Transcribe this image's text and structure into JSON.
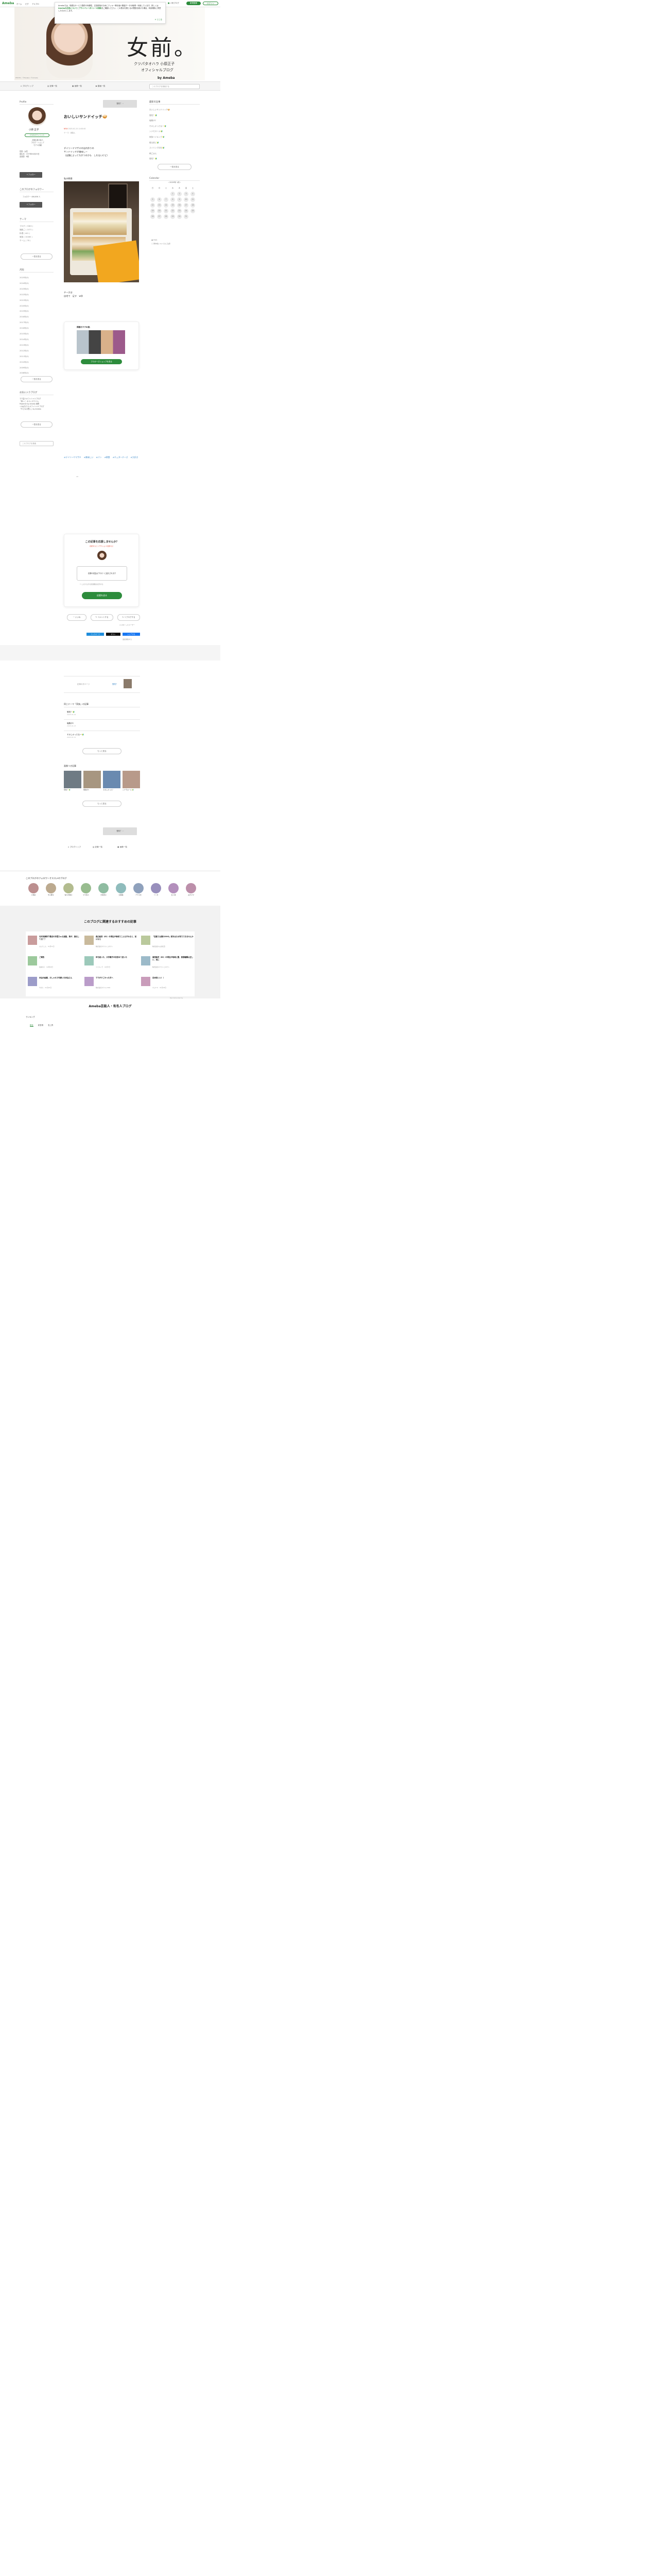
{
  "header": {
    "logo": "Ameba",
    "nav": [
      "ホーム",
      "ピグ",
      "アメブロ"
    ],
    "popular": "人気ブログ",
    "register": "新規登録",
    "login": "ログイン"
  },
  "cookie": {
    "text_a": "Amebaでは、快適なサービス提供や利便性、広告配信のためにクッキー等を個人関連データの取得・利用しています。詳しくは",
    "link1": "Amebaの広告について",
    "mid": "と",
    "link2": "プライバシーポリシーの規約",
    "text_b": "をご確認ください。この表示を閉じるか閲覧を続けた場合、利用規約に同意したものとします。",
    "close": "とじる"
  },
  "hero": {
    "title": "女前。",
    "sub1": "クツパタオハラ 小原正子",
    "sub2": "オフィシャルブログ",
    "by": "by Ameba",
    "photo_credit": "PHOTO：©Tanaka / ©Ameba"
  },
  "navbar": {
    "items": [
      "ブログトップ",
      "記事一覧",
      "画像一覧",
      "動画一覧"
    ],
    "search_placeholder": "このブログを検索する"
  },
  "left": {
    "profile_title": "Profile",
    "name": "小原 正子",
    "badge": "Amebaオフィシャル",
    "lines": [
      "大阪出身の芸人",
      "ブログ・ショップ",
      "モデル情報"
    ],
    "info": [
      "性別：女性",
      "誕生日：1975年04月25日",
      "血液型：B型"
    ],
    "follow_btn": "＋フォロー",
    "follower_title": "このブログのフォロワー",
    "follower_count": "フォロワー 406,656 人",
    "follow_btn2": "＋フォロー",
    "theme_title": "テーマ",
    "themes": [
      "ブログ ( 3363 )",
      "撮影ご ( 1071 )",
      "料理 ( 441 )",
      "家族 ( 10460 )",
      "チーム ( 78 )"
    ],
    "theme_more": "一覧を見る",
    "month_title": "月別",
    "months": [
      "2025年(0)",
      "2024年(0)",
      "2023年(0)",
      "2022年(0)",
      "2021年(0)",
      "2020年(0)",
      "2019年(0)",
      "2018年(0)",
      "2017年(0)",
      "2016年(0)",
      "2015年(0)",
      "2014年(0)",
      "2013年(0)",
      "2012年(0)",
      "2011年(0)",
      "2010年(0)",
      "2009年(0)",
      "2008年(0)"
    ],
    "month_more": "一覧を見る",
    "fav_title": "お気に入りブログ",
    "fav_lines": [
      "ママ芸人オフィシャルブログ",
      "「東っこ オペンスマイル」",
      "Powered by Ameba 東野",
      "くわばたりえオフィシャルブログ",
      "「やさ＆の思い」by Ameba"
    ],
    "fav_more": "一覧を見る",
    "search_placeholder": "このブログを検索"
  },
  "article": {
    "register_btn": "登校？",
    "title": "おいしいサンドイッチ🥪",
    "date_label": "NEW",
    "date": "2025-01-15 11:00:00",
    "theme": "テーマ：家族ん",
    "body": [
      "デイリーヤマザキの店内作りの",
      "サンドイッチが美味しー",
      "（店舗によってちがうのかも　しれないけど）"
    ],
    "photo_caption": "私の朝食",
    "after": [
      "チーズは",
      "自宅で　足す　w😄"
    ],
    "reco_title": "掲載おすすめ🛍",
    "reco_btn": "ブロガーズショップを見る",
    "tags": [
      "#デイリーヤマザキ",
      "#美味しい",
      "#パン",
      "#朝食",
      "#チェダーチーズ",
      "#大好き"
    ],
    "ad_label": "AD",
    "cheer_title": "この記事を応援しませんか？",
    "cheer_sub": "応援するとリアクションを送れる！",
    "cheer_box": "応援の収益はブロガーに還元されます",
    "cheer_note": "このブログの応援数を表示する",
    "cheer_btn": "応援を送る",
    "reactions": [
      "いいね",
      "コメントする",
      "リブログする"
    ],
    "reaction_count": "いいね！したユーザー",
    "share": [
      "ブックマーク",
      "ポスト",
      "シェアする"
    ],
    "report": "違反報告する",
    "prev": "記事の次ページ",
    "next": "登校？",
    "same_theme": "同じテーマ「家族」の記事",
    "same_list": [
      {
        "t": "登校？🔰",
        "d": "2025-01-14"
      },
      {
        "t": "瑠素がC",
        "d": "2025-01-13"
      },
      {
        "t": "そのしかったなー🔰",
        "d": "2025-01-12"
      }
    ],
    "same_more": "もっと見る",
    "img_title": "画像つき記事",
    "img_list": [
      "登校？🔰",
      "瑠素がC",
      "そのしかった？",
      "シナモロール🔰"
    ],
    "img_more": "もっと見る",
    "bottom_btn": "登校？",
    "bottom_nav": [
      "ブログトップ",
      "記事一覧",
      "画像一覧"
    ]
  },
  "right": {
    "recent_title": "最新の記事",
    "recent": [
      "おいしいサンドイッチ🥪",
      "登校？🔰",
      "瑠素がC",
      "そのしかったなー🔰",
      "シナモロール🔰",
      "家族ハイキング🔰",
      "寝る前に🔰",
      "スイミング初日🔰",
      "朝ごはん",
      "登校？🔰"
    ],
    "recent_more": "一覧を見る",
    "cal_title": "Calendar",
    "cal_month": "2025年 1月",
    "week": [
      "日",
      "月",
      "火",
      "水",
      "木",
      "金",
      "土"
    ],
    "rss": "RSS",
    "rss2": "著作権についてのご注意"
  },
  "followers": {
    "title": "このブログのフォロワーオススメのブログ",
    "items": [
      "小林彩",
      "牛川慶子",
      "佐々木優子",
      "ママ芸人",
      "大和田子",
      "辻貴美",
      "アナ子を",
      "ソンタ",
      "五人真",
      "みきママ"
    ]
  },
  "related": {
    "title": "このブログに関連するおすすめの記事",
    "items": [
      {
        "t": "元天気嬢柿下最近の手提ひゅる酒胆、茶が、進化してる？？",
        "s": "ももりこん",
        "d": "01月31日"
      },
      {
        "t": "森辺紹安（62）の現住が地域でこんな子みると、前川なら",
        "s": "株式会社ネクストコネクト",
        "d": ""
      },
      {
        "t": "「芸能では最のOOG」家計はなぜ何でできませんか",
        "s": "株式会社Q公益社団",
        "d": ""
      },
      {
        "t": "ご報告",
        "s": "佐藤文子",
        "d": "02月08日"
      },
      {
        "t": "年を経った、大学義子の収初めて送った",
        "s": "ミスキャラ",
        "d": "01月7日"
      },
      {
        "t": "高田紘史（62）の現住が地域に置、普通種類は正しい、気に",
        "s": "株式会社ネクストコネクト",
        "d": ""
      },
      {
        "t": "弁当の組載、おしゃれで可愛いお弁当さん",
        "s": "やまち",
        "d": "01月22日"
      },
      {
        "t": "ママがすごかった方へ",
        "s": "株式会社ネクストMKS",
        "d": ""
      },
      {
        "t": "白米炊いい！！",
        "s": "ネコヤマ",
        "d": "01月18日"
      }
    ],
    "footer": "Recommended by"
  },
  "famous": {
    "title": "Ameba芸能人・有名人ブログ",
    "ranking": "ランキング",
    "tabs": [
      "総合",
      "新登場",
      "急上昇"
    ]
  }
}
